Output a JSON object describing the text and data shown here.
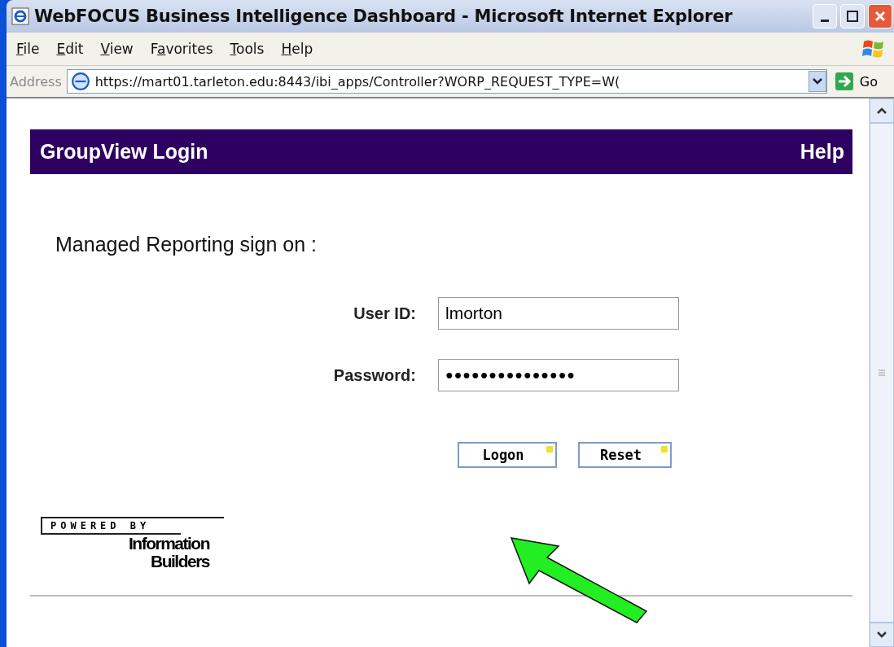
{
  "window": {
    "title": "WebFOCUS Business Intelligence Dashboard - Microsoft Internet Explorer"
  },
  "menu": [
    {
      "underlined": "F",
      "after": "ile"
    },
    {
      "underlined": "E",
      "after": "dit"
    },
    {
      "underlined": "V",
      "after": "iew"
    },
    {
      "before": "F",
      "underlined": "a",
      "after": "vorites"
    },
    {
      "underlined": "T",
      "after": "ools"
    },
    {
      "underlined": "H",
      "after": "elp"
    }
  ],
  "address_bar": {
    "label": "Address",
    "url": "https://mart01.tarleton.edu:8443/ibi_apps/Controller?WORP_REQUEST_TYPE=W(",
    "go": "Go"
  },
  "page": {
    "header": {
      "title": "GroupView Login",
      "help": "Help"
    },
    "heading": "Managed Reporting sign on :",
    "fields": [
      {
        "label": "User ID:",
        "value": "lmorton"
      },
      {
        "label": "Password:",
        "value": "●●●●●●●●●●●●●●●"
      }
    ],
    "buttons": [
      "Logon",
      "Reset"
    ],
    "logo": {
      "tagline": "POWERED BY",
      "line1": "Information",
      "line2": "Builders"
    }
  }
}
